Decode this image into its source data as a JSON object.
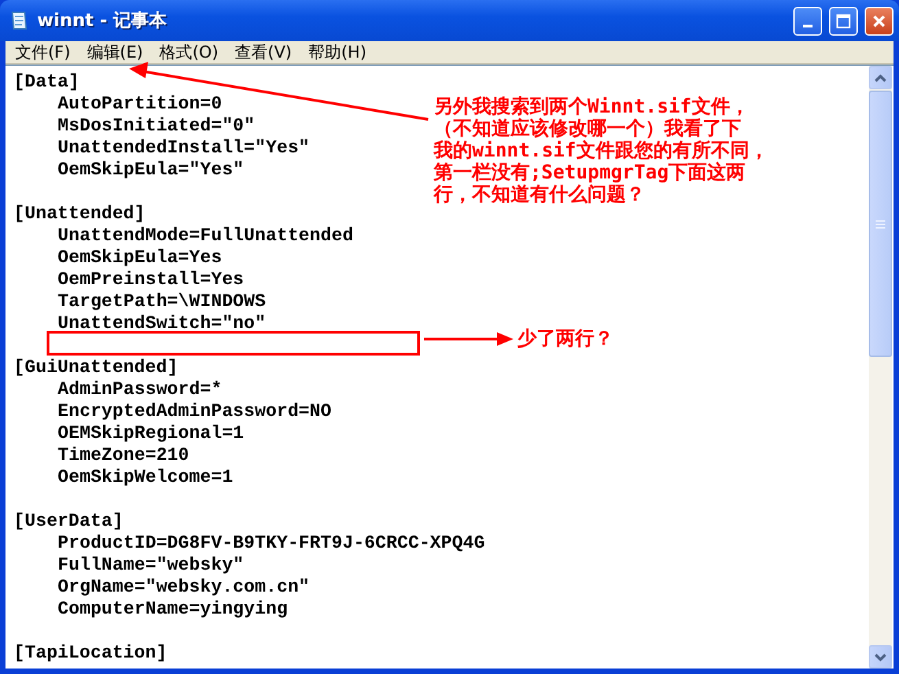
{
  "window": {
    "title": "winnt - 记事本"
  },
  "menu": [
    {
      "label": "文件(F)"
    },
    {
      "label": "编辑(E)"
    },
    {
      "label": "格式(O)"
    },
    {
      "label": "查看(V)"
    },
    {
      "label": "帮助(H)"
    }
  ],
  "lines": [
    {
      "kind": "section",
      "text": "[Data]"
    },
    {
      "kind": "entry",
      "text": "AutoPartition=0"
    },
    {
      "kind": "entry",
      "text": "MsDosInitiated=\"0\""
    },
    {
      "kind": "entry",
      "text": "UnattendedInstall=\"Yes\""
    },
    {
      "kind": "entry",
      "text": "OemSkipEula=\"Yes\""
    },
    {
      "kind": "blank"
    },
    {
      "kind": "section",
      "text": "[Unattended]"
    },
    {
      "kind": "entry",
      "text": "UnattendMode=FullUnattended"
    },
    {
      "kind": "entry",
      "text": "OemSkipEula=Yes"
    },
    {
      "kind": "entry",
      "text": "OemPreinstall=Yes"
    },
    {
      "kind": "entry",
      "text": "TargetPath=\\WINDOWS"
    },
    {
      "kind": "entry",
      "text": "UnattendSwitch=\"no\""
    },
    {
      "kind": "blank"
    },
    {
      "kind": "section",
      "text": "[GuiUnattended]"
    },
    {
      "kind": "entry",
      "text": "AdminPassword=*"
    },
    {
      "kind": "entry",
      "text": "EncryptedAdminPassword=NO"
    },
    {
      "kind": "entry",
      "text": "OEMSkipRegional=1"
    },
    {
      "kind": "entry",
      "text": "TimeZone=210"
    },
    {
      "kind": "entry",
      "text": "OemSkipWelcome=1"
    },
    {
      "kind": "blank"
    },
    {
      "kind": "section",
      "text": "[UserData]"
    },
    {
      "kind": "entry",
      "text": "ProductID=DG8FV-B9TKY-FRT9J-6CRCC-XPQ4G"
    },
    {
      "kind": "entry",
      "text": "FullName=\"websky\""
    },
    {
      "kind": "entry",
      "text": "OrgName=\"websky.com.cn\""
    },
    {
      "kind": "entry",
      "text": "ComputerName=yingying"
    },
    {
      "kind": "blank"
    },
    {
      "kind": "section",
      "text": "[TapiLocation]"
    }
  ],
  "annotations": [
    {
      "kind": "note",
      "lines": [
        "另外我搜索到两个Winnt.sif文件，",
        "（不知道应该修改哪一个）我看了下",
        "我的winnt.sif文件跟您的有所不同，",
        "第一栏没有;SetupmgrTag下面这两",
        "行，不知道有什么问题？"
      ]
    },
    {
      "kind": "marker",
      "lines": [
        "少了两行？"
      ]
    }
  ]
}
